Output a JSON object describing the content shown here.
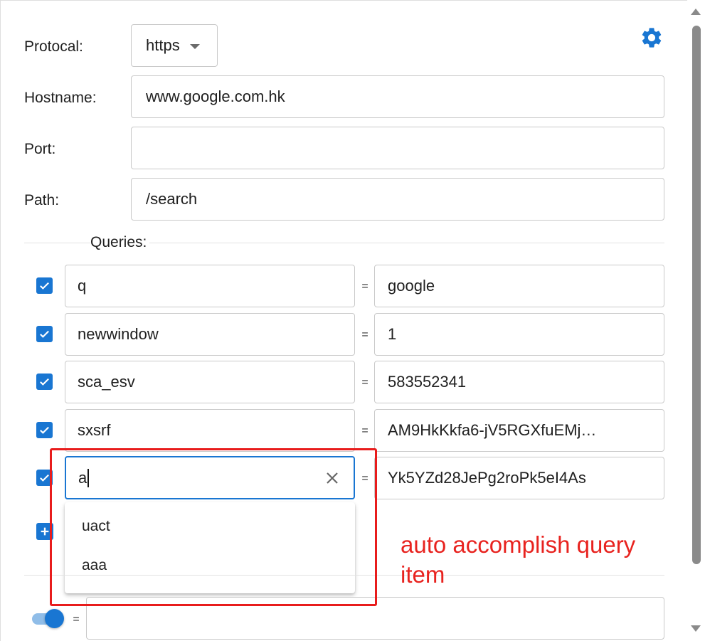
{
  "form": {
    "protocol_label": "Protocal:",
    "protocol_value": "https",
    "hostname_label": "Hostname:",
    "hostname_value": "www.google.com.hk",
    "port_label": "Port:",
    "port_value": "",
    "path_label": "Path:",
    "path_value": "/search"
  },
  "queries": {
    "title": "Queries:",
    "rows": [
      {
        "key": "q",
        "value": "google",
        "checked": true
      },
      {
        "key": "newwindow",
        "value": "1",
        "checked": true
      },
      {
        "key": "sca_esv",
        "value": "583552341",
        "checked": true
      },
      {
        "key": "sxsrf",
        "value": "AM9HkKkfa6-jV5RGXfuEMj…",
        "checked": true
      },
      {
        "key": "a",
        "value": "Yk5YZd28JePg2roPk5eI4As",
        "checked": true
      }
    ],
    "equals_sign": "="
  },
  "autocomplete": {
    "options": [
      "uact",
      "aaa"
    ]
  },
  "annotation": {
    "text": "auto accomplish query item",
    "color": "#e8231f"
  },
  "footer": {
    "equals_sign": "=",
    "value": "",
    "toggle_on": true
  },
  "colors": {
    "accent": "#1976d2",
    "highlight": "#e81c1c"
  }
}
